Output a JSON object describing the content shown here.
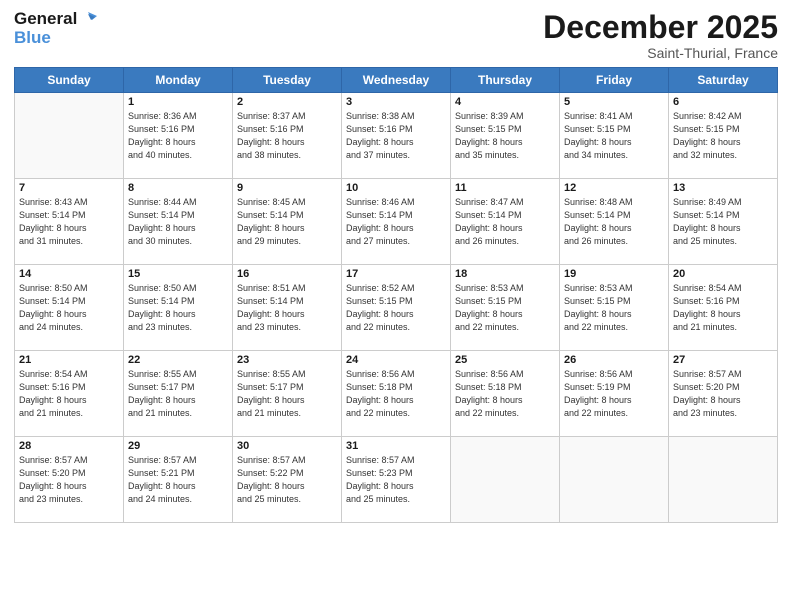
{
  "header": {
    "logo_line1": "General",
    "logo_line2": "Blue",
    "month": "December 2025",
    "location": "Saint-Thurial, France"
  },
  "weekdays": [
    "Sunday",
    "Monday",
    "Tuesday",
    "Wednesday",
    "Thursday",
    "Friday",
    "Saturday"
  ],
  "weeks": [
    [
      {
        "day": "",
        "info": ""
      },
      {
        "day": "1",
        "info": "Sunrise: 8:36 AM\nSunset: 5:16 PM\nDaylight: 8 hours\nand 40 minutes."
      },
      {
        "day": "2",
        "info": "Sunrise: 8:37 AM\nSunset: 5:16 PM\nDaylight: 8 hours\nand 38 minutes."
      },
      {
        "day": "3",
        "info": "Sunrise: 8:38 AM\nSunset: 5:16 PM\nDaylight: 8 hours\nand 37 minutes."
      },
      {
        "day": "4",
        "info": "Sunrise: 8:39 AM\nSunset: 5:15 PM\nDaylight: 8 hours\nand 35 minutes."
      },
      {
        "day": "5",
        "info": "Sunrise: 8:41 AM\nSunset: 5:15 PM\nDaylight: 8 hours\nand 34 minutes."
      },
      {
        "day": "6",
        "info": "Sunrise: 8:42 AM\nSunset: 5:15 PM\nDaylight: 8 hours\nand 32 minutes."
      }
    ],
    [
      {
        "day": "7",
        "info": "Sunrise: 8:43 AM\nSunset: 5:14 PM\nDaylight: 8 hours\nand 31 minutes."
      },
      {
        "day": "8",
        "info": "Sunrise: 8:44 AM\nSunset: 5:14 PM\nDaylight: 8 hours\nand 30 minutes."
      },
      {
        "day": "9",
        "info": "Sunrise: 8:45 AM\nSunset: 5:14 PM\nDaylight: 8 hours\nand 29 minutes."
      },
      {
        "day": "10",
        "info": "Sunrise: 8:46 AM\nSunset: 5:14 PM\nDaylight: 8 hours\nand 27 minutes."
      },
      {
        "day": "11",
        "info": "Sunrise: 8:47 AM\nSunset: 5:14 PM\nDaylight: 8 hours\nand 26 minutes."
      },
      {
        "day": "12",
        "info": "Sunrise: 8:48 AM\nSunset: 5:14 PM\nDaylight: 8 hours\nand 26 minutes."
      },
      {
        "day": "13",
        "info": "Sunrise: 8:49 AM\nSunset: 5:14 PM\nDaylight: 8 hours\nand 25 minutes."
      }
    ],
    [
      {
        "day": "14",
        "info": "Sunrise: 8:50 AM\nSunset: 5:14 PM\nDaylight: 8 hours\nand 24 minutes."
      },
      {
        "day": "15",
        "info": "Sunrise: 8:50 AM\nSunset: 5:14 PM\nDaylight: 8 hours\nand 23 minutes."
      },
      {
        "day": "16",
        "info": "Sunrise: 8:51 AM\nSunset: 5:14 PM\nDaylight: 8 hours\nand 23 minutes."
      },
      {
        "day": "17",
        "info": "Sunrise: 8:52 AM\nSunset: 5:15 PM\nDaylight: 8 hours\nand 22 minutes."
      },
      {
        "day": "18",
        "info": "Sunrise: 8:53 AM\nSunset: 5:15 PM\nDaylight: 8 hours\nand 22 minutes."
      },
      {
        "day": "19",
        "info": "Sunrise: 8:53 AM\nSunset: 5:15 PM\nDaylight: 8 hours\nand 22 minutes."
      },
      {
        "day": "20",
        "info": "Sunrise: 8:54 AM\nSunset: 5:16 PM\nDaylight: 8 hours\nand 21 minutes."
      }
    ],
    [
      {
        "day": "21",
        "info": "Sunrise: 8:54 AM\nSunset: 5:16 PM\nDaylight: 8 hours\nand 21 minutes."
      },
      {
        "day": "22",
        "info": "Sunrise: 8:55 AM\nSunset: 5:17 PM\nDaylight: 8 hours\nand 21 minutes."
      },
      {
        "day": "23",
        "info": "Sunrise: 8:55 AM\nSunset: 5:17 PM\nDaylight: 8 hours\nand 21 minutes."
      },
      {
        "day": "24",
        "info": "Sunrise: 8:56 AM\nSunset: 5:18 PM\nDaylight: 8 hours\nand 22 minutes."
      },
      {
        "day": "25",
        "info": "Sunrise: 8:56 AM\nSunset: 5:18 PM\nDaylight: 8 hours\nand 22 minutes."
      },
      {
        "day": "26",
        "info": "Sunrise: 8:56 AM\nSunset: 5:19 PM\nDaylight: 8 hours\nand 22 minutes."
      },
      {
        "day": "27",
        "info": "Sunrise: 8:57 AM\nSunset: 5:20 PM\nDaylight: 8 hours\nand 23 minutes."
      }
    ],
    [
      {
        "day": "28",
        "info": "Sunrise: 8:57 AM\nSunset: 5:20 PM\nDaylight: 8 hours\nand 23 minutes."
      },
      {
        "day": "29",
        "info": "Sunrise: 8:57 AM\nSunset: 5:21 PM\nDaylight: 8 hours\nand 24 minutes."
      },
      {
        "day": "30",
        "info": "Sunrise: 8:57 AM\nSunset: 5:22 PM\nDaylight: 8 hours\nand 25 minutes."
      },
      {
        "day": "31",
        "info": "Sunrise: 8:57 AM\nSunset: 5:23 PM\nDaylight: 8 hours\nand 25 minutes."
      },
      {
        "day": "",
        "info": ""
      },
      {
        "day": "",
        "info": ""
      },
      {
        "day": "",
        "info": ""
      }
    ]
  ]
}
